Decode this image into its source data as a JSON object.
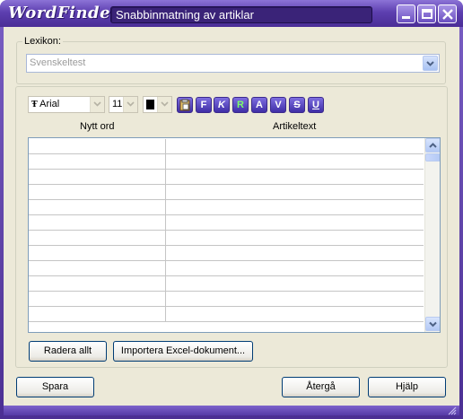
{
  "app": {
    "logo": "WordFinder",
    "title": "Snabbinmatning av artiklar"
  },
  "lexikon": {
    "label": "Lexikon:",
    "value": "Svenskeltest"
  },
  "toolbar": {
    "font": "Arial",
    "size": "11",
    "format_buttons": [
      "F",
      "K",
      "R",
      "A",
      "V",
      "S",
      "U"
    ]
  },
  "columns": {
    "word": "Nytt ord",
    "article": "Artikeltext"
  },
  "grid": {
    "row_count": 12
  },
  "buttons": {
    "clear_all": "Radera allt",
    "import_excel": "Importera Excel-dokument...",
    "save": "Spara",
    "undo": "Återgå",
    "help": "Hjälp"
  },
  "colors": {
    "titlebar": "#5d3fb0",
    "dialog": "#ece9d8",
    "format_button": "#4a36b0"
  }
}
